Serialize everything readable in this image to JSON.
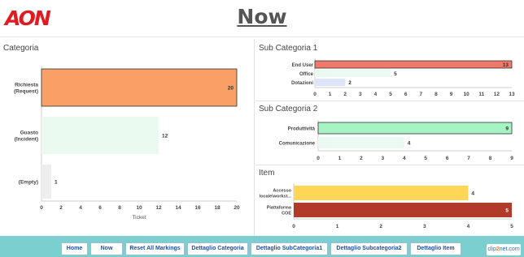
{
  "header": {
    "logo_text": "AON",
    "page_title": "Now"
  },
  "panels": {
    "categoria": {
      "title": "Categoria"
    },
    "sub1": {
      "title": "Sub Categoria 1"
    },
    "sub2": {
      "title": "Sub Categoria 2"
    },
    "item": {
      "title": "Item"
    }
  },
  "chart_data": [
    {
      "id": "categoria",
      "type": "bar",
      "orientation": "horizontal",
      "categories": [
        [
          "Richiesta",
          "(Request)"
        ],
        [
          "Guasto",
          "(Incident)"
        ],
        [
          "(Empty)"
        ]
      ],
      "values": [
        20,
        12,
        1
      ],
      "colors": [
        "#f9a066",
        "#eafaf0",
        "#eeeeee"
      ],
      "bar_borders": [
        "#333333",
        "none",
        "none"
      ],
      "xlabel": "Ticket",
      "xlim": [
        0,
        20
      ],
      "ticks": [
        0,
        2,
        4,
        6,
        8,
        10,
        12,
        14,
        16,
        18,
        20
      ]
    },
    {
      "id": "sub1",
      "type": "bar",
      "orientation": "horizontal",
      "categories": [
        [
          "End User"
        ],
        [
          "Office"
        ],
        [
          "Dotazioni"
        ]
      ],
      "values": [
        13,
        5,
        2
      ],
      "colors": [
        "#f07a6a",
        "#eafaf0",
        "#dde5fb"
      ],
      "bar_borders": [
        "#333333",
        "none",
        "none"
      ],
      "xlim": [
        0,
        13
      ],
      "ticks": [
        0,
        1,
        2,
        3,
        4,
        5,
        6,
        7,
        8,
        9,
        10,
        11,
        12,
        13
      ]
    },
    {
      "id": "sub2",
      "type": "bar",
      "orientation": "horizontal",
      "categories": [
        [
          "Produttività"
        ],
        [
          "Comunicazione"
        ]
      ],
      "values": [
        9,
        4
      ],
      "colors": [
        "#a6f3c4",
        "#eafaf0"
      ],
      "bar_borders": [
        "#333333",
        "none"
      ],
      "xlim": [
        0,
        9
      ],
      "ticks": [
        0,
        1,
        2,
        3,
        4,
        5,
        6,
        7,
        8,
        9
      ]
    },
    {
      "id": "item",
      "type": "bar",
      "orientation": "horizontal",
      "categories": [
        [
          "Accesso",
          "locale\\workst..."
        ],
        [
          "Piattaforma",
          "COE"
        ]
      ],
      "values": [
        4,
        5
      ],
      "colors": [
        "#ffd656",
        "#b23a2a"
      ],
      "bar_borders": [
        "none",
        "none"
      ],
      "value_label_colors": [
        "#333333",
        "#ffffff"
      ],
      "xlim": [
        0,
        5
      ],
      "ticks": [
        0,
        1,
        2,
        3,
        4,
        5
      ]
    }
  ],
  "nav": {
    "buttons": [
      "Home",
      "Now",
      "Reset All Markings",
      "Dettaglio Categoria",
      "Dettaglio SubCategoria1",
      "Dettaglio Subcategoria2",
      "Dettaglio Item"
    ]
  },
  "watermark": {
    "text_a": "clip",
    "text_b": "2",
    "text_c": "net.com"
  }
}
